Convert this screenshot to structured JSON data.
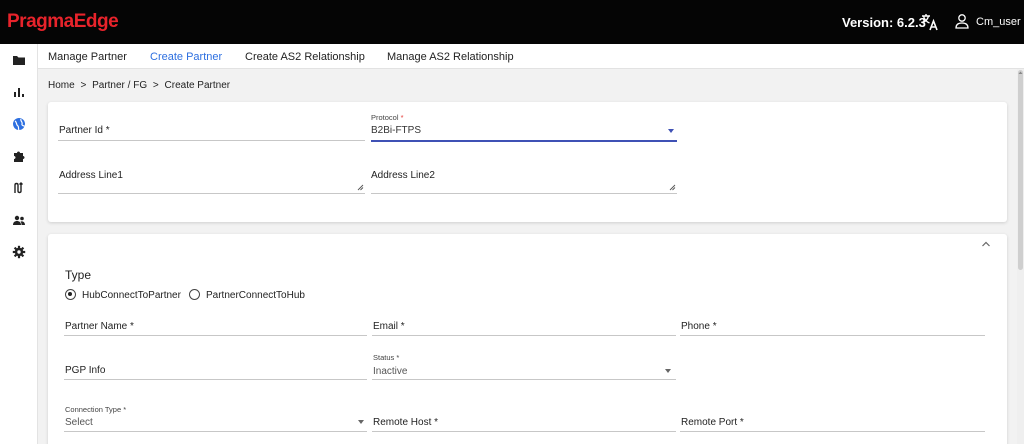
{
  "app": {
    "brand": "PragmaEdge",
    "version": "Version: 6.2.3",
    "user": "Cm_user"
  },
  "sidebar": {
    "items": [
      {
        "icon": "folder-icon"
      },
      {
        "icon": "bar-chart-icon"
      },
      {
        "icon": "globe-icon",
        "active": true
      },
      {
        "icon": "puzzle-icon"
      },
      {
        "icon": "route-icon"
      },
      {
        "icon": "users-icon"
      },
      {
        "icon": "gear-icon"
      }
    ]
  },
  "tabs": [
    {
      "label": "Manage Partner"
    },
    {
      "label": "Create Partner",
      "active": true
    },
    {
      "label": "Create AS2 Relationship"
    },
    {
      "label": "Manage AS2 Relationship"
    }
  ],
  "breadcrumb": [
    "Home",
    ">",
    "Partner / FG",
    ">",
    "Create Partner"
  ],
  "form": {
    "partner_id": {
      "label": "Partner Id *"
    },
    "protocol": {
      "label": "Protocol",
      "required_mark": "*",
      "value": "B2Bi-FTPS"
    },
    "address_line1": {
      "label": "Address Line1"
    },
    "address_line2": {
      "label": "Address Line2"
    }
  },
  "partner_section": {
    "type_label": "Type",
    "type_options": [
      {
        "label": "HubConnectToPartner",
        "selected": true
      },
      {
        "label": "PartnerConnectToHub",
        "selected": false
      }
    ],
    "partner_name": {
      "label": "Partner Name *"
    },
    "email": {
      "label": "Email *"
    },
    "phone": {
      "label": "Phone *"
    },
    "pgp_info": {
      "label": "PGP Info"
    },
    "status": {
      "label": "Status *",
      "value": "Inactive"
    },
    "connection_type": {
      "label": "Connection Type *",
      "value": "Select"
    },
    "remote_host": {
      "label": "Remote Host *"
    },
    "remote_port": {
      "label": "Remote Port *"
    }
  },
  "colors": {
    "brand": "#e8232b",
    "accent": "#2d6fe0",
    "focus": "#3f51b5",
    "topbar": "#050505"
  }
}
